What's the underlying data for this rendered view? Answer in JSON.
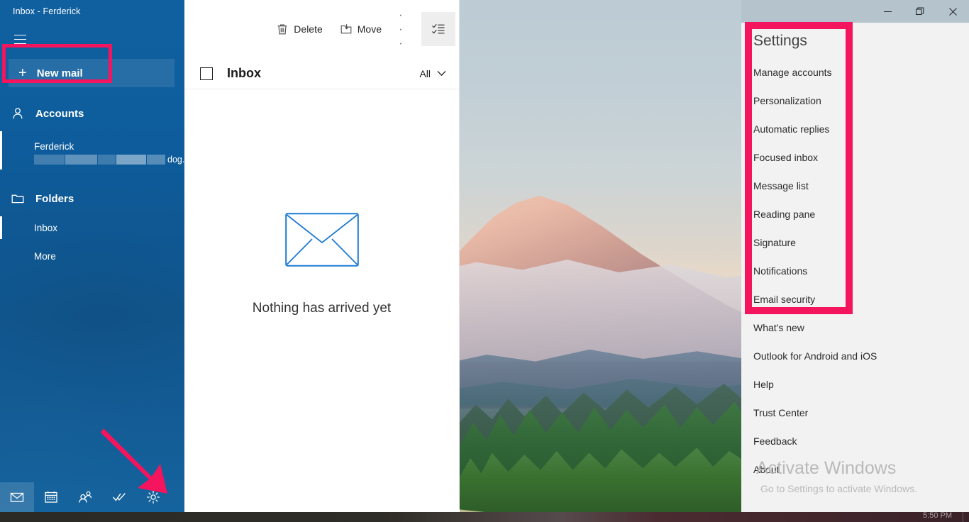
{
  "window": {
    "title": "Inbox - Ferderick",
    "controls": [
      {
        "name": "minimize",
        "glyph": "—"
      },
      {
        "name": "maximize",
        "glyph": "❐"
      },
      {
        "name": "close",
        "glyph": "✕"
      }
    ]
  },
  "sidebar": {
    "hamburger_label": "Navigation",
    "new_mail": {
      "plus": "+",
      "label": "New mail"
    },
    "accounts_section": {
      "label": "Accounts",
      "icon": "person-icon"
    },
    "account": {
      "name": "Ferderick",
      "email_tail": "dog...",
      "email_redacted": true
    },
    "folders_section": {
      "label": "Folders",
      "icon": "folder-icon"
    },
    "folders": [
      {
        "label": "Inbox",
        "selected": true
      },
      {
        "label": "More",
        "selected": false
      }
    ],
    "bottom_bar": [
      {
        "name": "mail-icon",
        "label": "Mail",
        "active": true
      },
      {
        "name": "calendar-icon",
        "label": "Calendar",
        "active": false
      },
      {
        "name": "people-icon",
        "label": "People",
        "active": false
      },
      {
        "name": "todo-icon",
        "label": "To Do",
        "active": false
      },
      {
        "name": "gear-icon",
        "label": "Settings",
        "active": false
      }
    ]
  },
  "mail_pane": {
    "toolbar": {
      "delete_label": "Delete",
      "move_label": "Move",
      "more_label": "· · ·",
      "selection_mode_label": "Enter selection mode"
    },
    "header": {
      "folder_title": "Inbox",
      "filter_label": "All",
      "select_all_label": "Select all"
    },
    "empty_state": {
      "message": "Nothing has arrived yet",
      "icon": "envelope-icon"
    }
  },
  "settings_panel": {
    "title": "Settings",
    "items": [
      {
        "label": "Manage accounts",
        "highlighted": true
      },
      {
        "label": "Personalization",
        "highlighted": true
      },
      {
        "label": "Automatic replies",
        "highlighted": true
      },
      {
        "label": "Focused inbox",
        "highlighted": true
      },
      {
        "label": "Message list",
        "highlighted": true
      },
      {
        "label": "Reading pane",
        "highlighted": true
      },
      {
        "label": "Signature",
        "highlighted": true
      },
      {
        "label": "Notifications",
        "highlighted": true
      },
      {
        "label": "Email security",
        "highlighted": true
      },
      {
        "label": "What's new",
        "highlighted": false
      },
      {
        "label": "Outlook for Android and iOS",
        "highlighted": false
      },
      {
        "label": "Help",
        "highlighted": false
      },
      {
        "label": "Trust Center",
        "highlighted": false
      },
      {
        "label": "Feedback",
        "highlighted": false
      },
      {
        "label": "About",
        "highlighted": false
      }
    ]
  },
  "watermark": {
    "line1": "Activate Windows",
    "line2": "Go to Settings to activate Windows."
  },
  "taskbar": {
    "clock": "5:50 PM"
  },
  "annotations": {
    "highlight_color": "#f5145e",
    "arrow_color": "#f5145e",
    "arrow_target": "gear-icon",
    "new_mail_box": "New mail button highlight",
    "settings_box": "Settings items highlight"
  },
  "colors": {
    "nav_blue": "#0f5f9e",
    "accent": "#0078d7",
    "titlebar": "#b5c3cd",
    "settings_bg": "#f2f2f2"
  }
}
